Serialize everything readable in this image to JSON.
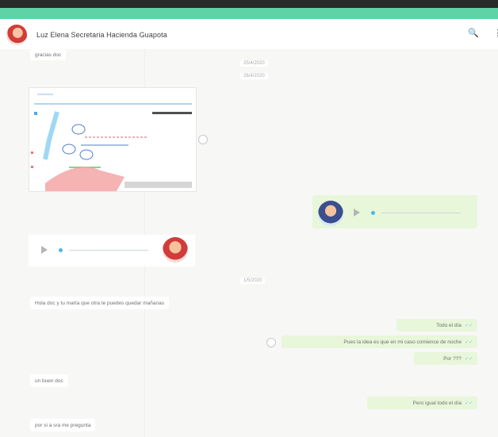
{
  "header": {
    "contact_name": "Luz Elena Secretaria Hacienda Guapota",
    "search_icon": "🔍",
    "menu_icon": "⋮"
  },
  "dates": [
    "25/4/2020",
    "26/4/2020",
    "1/5/2020"
  ],
  "messages": [
    {
      "dir": "in",
      "text": "gracias doc"
    },
    {
      "dir": "in",
      "text": "Hola doc y tu marta que otra te puedes quedar mañanas"
    },
    {
      "dir": "out",
      "text": "Todo el día"
    },
    {
      "dir": "out",
      "text": "Pues la idea es que en mi caso comience de noche"
    },
    {
      "dir": "out",
      "text": "Por ???"
    },
    {
      "dir": "in",
      "text": "un buen doc"
    },
    {
      "dir": "out",
      "text": "Pero igual todo el día"
    },
    {
      "dir": "in",
      "text": "por si a sra me pregunta"
    }
  ],
  "colors": {
    "accent": "#5fd3a6",
    "incoming": "#ffffff",
    "outgoing": "#e8f6da",
    "tick": "#7cc8e6"
  }
}
